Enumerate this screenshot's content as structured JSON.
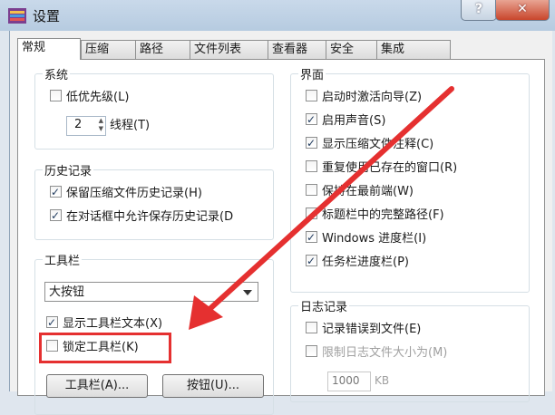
{
  "window": {
    "title": "设置",
    "help_glyph": "?",
    "close_glyph": "✕"
  },
  "tabs": [
    "常规",
    "压缩",
    "路径",
    "文件列表",
    "查看器",
    "安全",
    "集成"
  ],
  "system": {
    "title": "系统",
    "low_priority": {
      "label": "低优先级(L)",
      "checked": false
    },
    "threads_value": "2",
    "threads_label": "线程(T)"
  },
  "history": {
    "title": "历史记录",
    "items": [
      {
        "label": "保留压缩文件历史记录(H)",
        "checked": true
      },
      {
        "label": "在对话框中允许保存历史记录(D",
        "checked": true
      }
    ]
  },
  "toolbar": {
    "title": "工具栏",
    "select_value": "大按钮",
    "show_text": {
      "label": "显示工具栏文本(X)",
      "checked": true
    },
    "lock": {
      "label": "锁定工具栏(K)",
      "checked": false
    },
    "toolbar_button": "工具栏(A)...",
    "buttons_button": "按钮(U)..."
  },
  "interface": {
    "title": "界面",
    "items": [
      {
        "label": "启动时激活向导(Z)",
        "checked": false
      },
      {
        "label": "启用声音(S)",
        "checked": true
      },
      {
        "label": "显示压缩文件注释(C)",
        "checked": true
      },
      {
        "label": "重复使用已存在的窗口(R)",
        "checked": false
      },
      {
        "label": "保持在最前端(W)",
        "checked": false
      },
      {
        "label": "标题栏中的完整路径(F)",
        "checked": false
      },
      {
        "label": "Windows 进度栏(I)",
        "checked": true
      },
      {
        "label": "任务栏进度栏(P)",
        "checked": true
      }
    ]
  },
  "log": {
    "title": "日志记录",
    "log_errors": {
      "label": "记录错误到文件(E)",
      "checked": false
    },
    "limit_size": {
      "label": "限制日志文件大小为(M)",
      "checked": false,
      "disabled": true
    },
    "size_value": "1000",
    "size_unit": "KB"
  },
  "colors": {
    "annotation": "#e53030"
  }
}
